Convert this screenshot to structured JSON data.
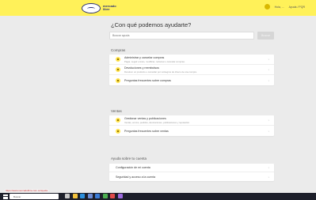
{
  "header": {
    "logo_text": "mercado libre",
    "user_label": "Hola, ...",
    "links_label": "Ayuda / PQR"
  },
  "main": {
    "title": "¿Con qué podemos ayudarte?",
    "search": {
      "placeholder": "Buscar ayuda",
      "button": "Buscar"
    },
    "sections": [
      {
        "title": "Compras",
        "items": [
          {
            "label": "Administrar y cancelar compras",
            "desc": "Pagar, seguir envíos, modificar, reclamar o cancelar compras.",
            "icon": "bag-icon"
          },
          {
            "label": "Devoluciones y reembolsos",
            "desc": "Devolver un producto o consultar por reintegros de dinero de una compra.",
            "icon": "refund-icon"
          },
          {
            "label": "Preguntas frecuentes sobre compras",
            "desc": "",
            "icon": "question-icon"
          }
        ]
      },
      {
        "title": "Ventas",
        "items": [
          {
            "label": "Gestionar ventas y publicaciones",
            "desc": "Ventas, envíos, pedidos, devoluciones, publicaciones y reputación.",
            "icon": "tag-icon"
          },
          {
            "label": "Preguntas frecuentes sobre ventas",
            "desc": "",
            "icon": "question-icon"
          }
        ]
      },
      {
        "title": "Ayuda sobre tu cuenta",
        "items": [
          {
            "label": "Configuración de mi cuenta"
          },
          {
            "label": "Seguridad y acceso a la cuenta"
          }
        ]
      }
    ]
  },
  "status_url": "https://www.mercadolibre.com.co/ayuda",
  "taskbar": {
    "search_placeholder": "Buscar",
    "time": "",
    "icons": [
      {
        "name": "task-view-icon",
        "color": "#c8c8c8"
      },
      {
        "name": "file-explorer-icon",
        "color": "#f3c23c"
      },
      {
        "name": "edge-icon",
        "color": "#2c8fdc"
      },
      {
        "name": "store-icon",
        "color": "#6c8cd5"
      },
      {
        "name": "mail-icon",
        "color": "#3a7bd5"
      },
      {
        "name": "chrome-icon",
        "color": "#4caf50"
      },
      {
        "name": "app-icon",
        "color": "#e04b4b"
      },
      {
        "name": "app-icon-2",
        "color": "#9c6ade"
      }
    ]
  }
}
